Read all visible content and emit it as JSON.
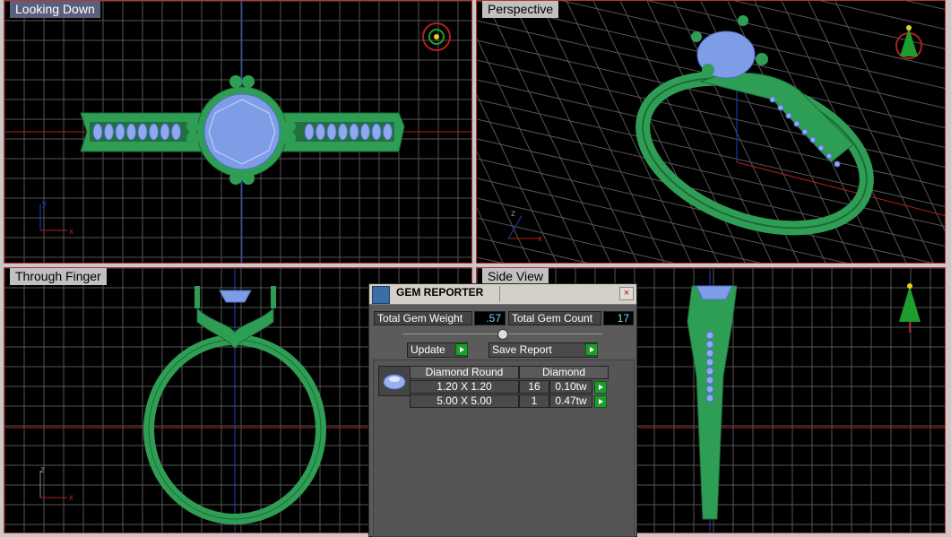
{
  "viewports": {
    "top_left": {
      "label": "Looking Down",
      "active": true
    },
    "top_right": {
      "label": "Perspective",
      "active": false
    },
    "bottom_left": {
      "label": "Through Finger",
      "active": false
    },
    "bottom_right": {
      "label": "Side View",
      "active": false
    }
  },
  "axes": {
    "x": "x",
    "y": "y",
    "z": "z"
  },
  "gem_reporter": {
    "title": "GEM REPORTER",
    "close": "×",
    "total_weight_label": "Total Gem Weight",
    "total_weight_value": ".57",
    "total_count_label": "Total Gem Count",
    "total_count_value": "17",
    "update_label": "Update",
    "save_label": "Save Report",
    "table": {
      "header": [
        "Diamond Round",
        "Diamond"
      ],
      "rows": [
        {
          "size": "1.20 X 1.20",
          "count": "16",
          "weight": "0.10tw"
        },
        {
          "size": "5.00 X 5.00",
          "count": "1",
          "weight": "0.47tw"
        }
      ]
    }
  },
  "colors": {
    "metal": "#36b060",
    "metal_dark": "#1d6b3a",
    "gem": "#7f9de6",
    "grid": "#5a5a5a",
    "axis_x": "#b02020",
    "axis_y": "#2040c0",
    "accent_go": "#1e9c2e"
  },
  "icons": [
    "gem-reporter-logo-icon",
    "close-icon",
    "play-arrow-icon",
    "diamond-icon",
    "view-cube-icon"
  ]
}
